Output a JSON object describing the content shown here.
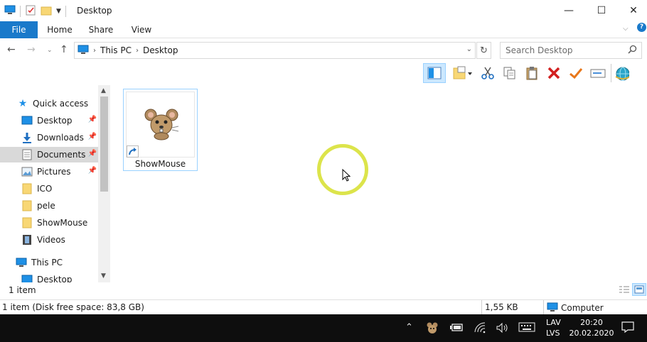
{
  "window": {
    "title": "Desktop",
    "minimize": "—",
    "maximize": "☐",
    "close": "✕"
  },
  "ribbon": {
    "tabs": [
      "File",
      "Home",
      "Share",
      "View"
    ]
  },
  "address": {
    "segments": [
      "This PC",
      "Desktop"
    ],
    "search_placeholder": "Search Desktop"
  },
  "nav": {
    "quick_access": "Quick access",
    "items": [
      {
        "label": "Desktop",
        "pinned": true
      },
      {
        "label": "Downloads",
        "pinned": true
      },
      {
        "label": "Documents",
        "pinned": true
      },
      {
        "label": "Pictures",
        "pinned": true
      },
      {
        "label": "ICO",
        "pinned": false
      },
      {
        "label": "pele",
        "pinned": false
      },
      {
        "label": "ShowMouse",
        "pinned": false
      },
      {
        "label": "Videos",
        "pinned": false
      }
    ],
    "this_pc": "This PC",
    "this_pc_child": "Desktop"
  },
  "content": {
    "file_name": "ShowMouse"
  },
  "status": {
    "item_count": "1 item",
    "disk_info": "1 item (Disk free space: 83,8 GB)",
    "size": "1,55 KB",
    "location": "Computer"
  },
  "taskbar": {
    "lang_line1": "LAV",
    "lang_line2": "LVS",
    "time": "20:20",
    "date": "20.02.2020"
  },
  "colors": {
    "accent": "#1979ca",
    "selection": "#cce8ff",
    "cursor_ring": "#d6df2c"
  }
}
